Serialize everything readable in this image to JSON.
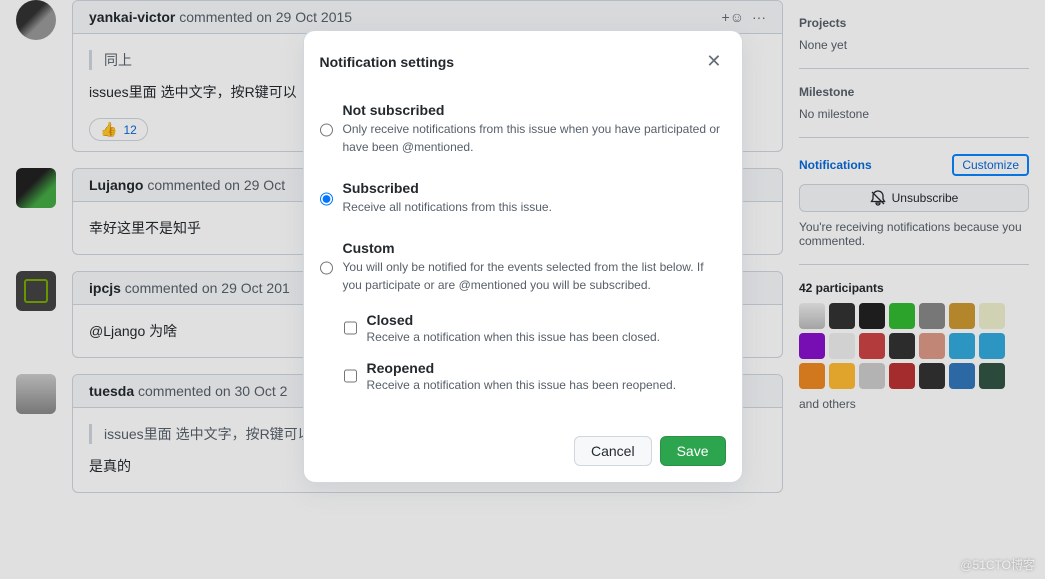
{
  "comments": [
    {
      "author": "yankai-victor",
      "verb": "commented",
      "date": "on 29 Oct 2015",
      "quote": "同上",
      "body": "issues里面 选中文字，按R键可以",
      "reaction_emoji": "👍",
      "reaction_count": "12",
      "show_header_actions": true
    },
    {
      "author": "Lujango",
      "verb": "commented",
      "date": "on 29 Oct",
      "body": "幸好这里不是知乎"
    },
    {
      "author": "ipcjs",
      "verb": "commented",
      "date": "on 29 Oct 201",
      "body": "@Ljango 为啥"
    },
    {
      "author": "tuesda",
      "verb": "commented",
      "date": "on 30 Oct 2",
      "quote": "issues里面 选中文字，按R键可以快速引用",
      "body": "是真的"
    }
  ],
  "sidebar": {
    "projects_title": "Projects",
    "projects_value": "None yet",
    "milestone_title": "Milestone",
    "milestone_value": "No milestone",
    "notifications_title": "Notifications",
    "customize_label": "Customize",
    "unsubscribe_label": "Unsubscribe",
    "notif_note": "You're receiving notifications because you commented.",
    "participants_title": "42 participants",
    "others_text": "and others"
  },
  "modal": {
    "title": "Notification settings",
    "options": [
      {
        "title": "Not subscribed",
        "desc": "Only receive notifications from this issue when you have participated or have been @mentioned.",
        "checked": false
      },
      {
        "title": "Subscribed",
        "desc": "Receive all notifications from this issue.",
        "checked": true
      },
      {
        "title": "Custom",
        "desc": "You will only be notified for the events selected from the list below. If you participate or are @mentioned you will be subscribed.",
        "checked": false
      }
    ],
    "custom_events": [
      {
        "title": "Closed",
        "desc": "Receive a notification when this issue has been closed."
      },
      {
        "title": "Reopened",
        "desc": "Receive a notification when this issue has been reopened."
      }
    ],
    "cancel_label": "Cancel",
    "save_label": "Save"
  },
  "watermark": "@51CTO博客"
}
